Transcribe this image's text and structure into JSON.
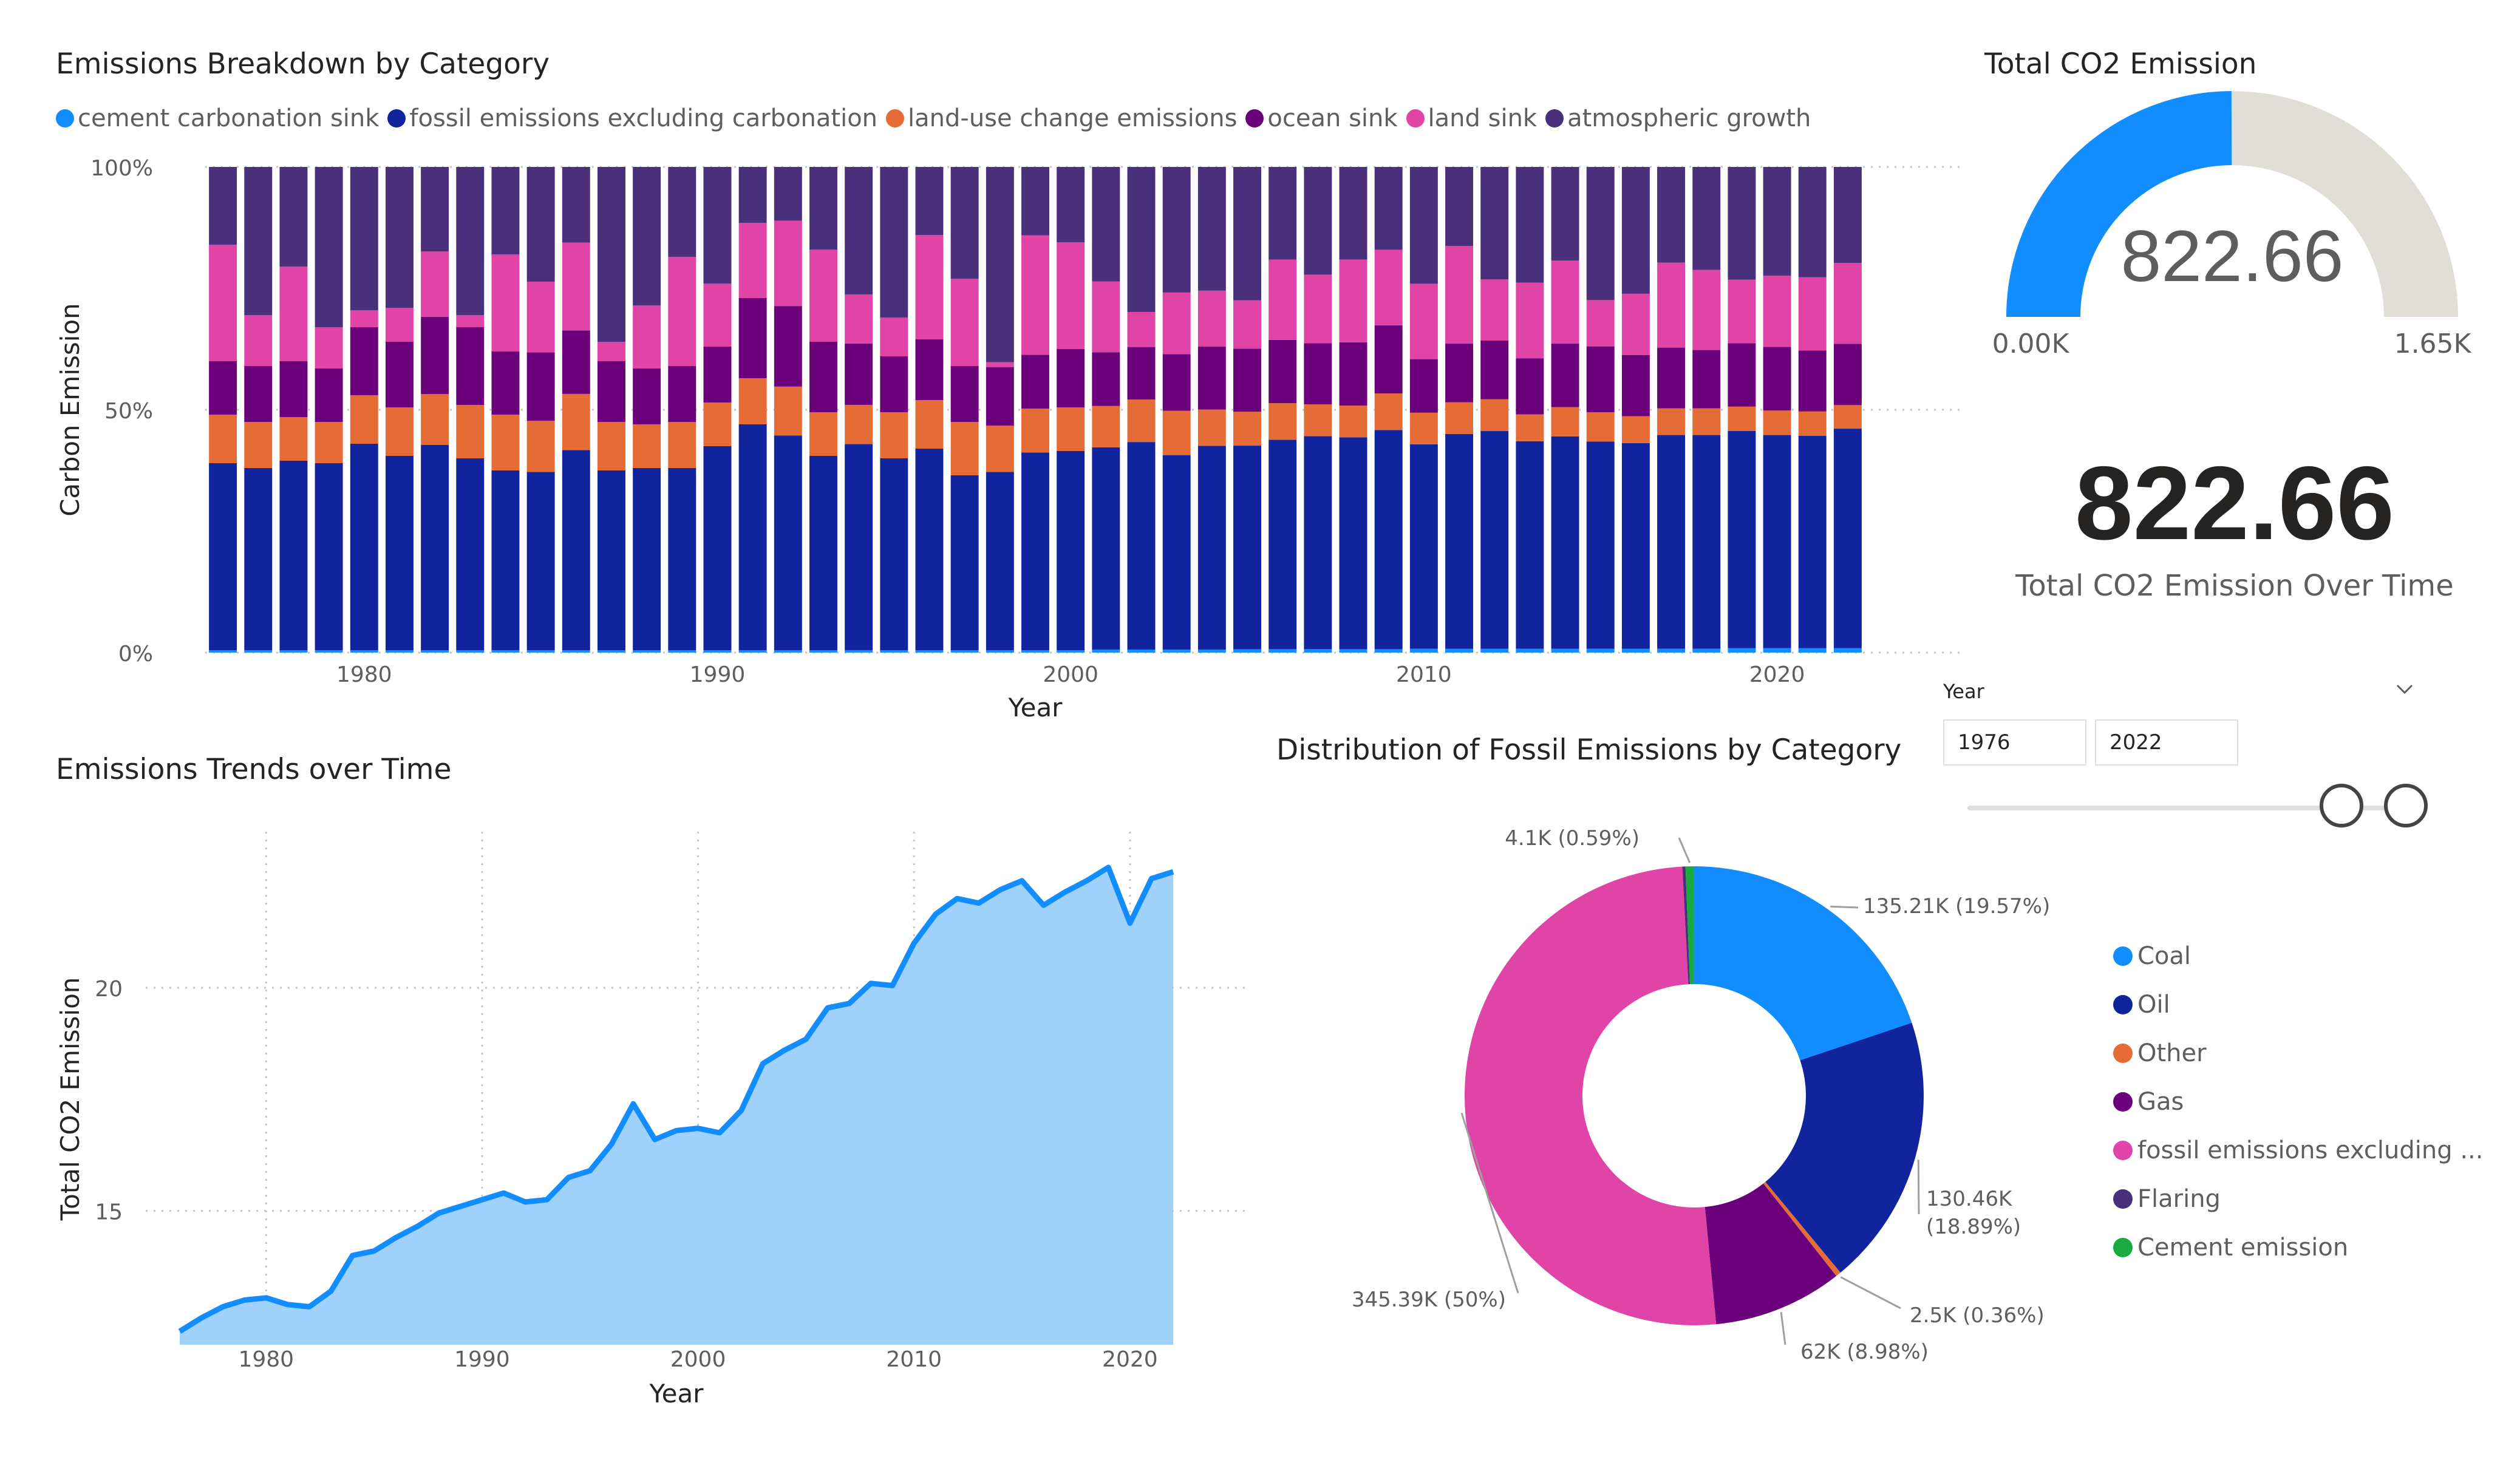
{
  "colors": {
    "cement_sink": "#118dff",
    "fossil": "#12239e",
    "landuse": "#e66c37",
    "ocean": "#6b007b",
    "land_sink": "#e044a7",
    "atmos": "#4a2f7a",
    "area_fill": "#9fd1fb",
    "area_line": "#118dff",
    "gauge_fill": "#118dff",
    "gauge_bg": "#e1ddd7"
  },
  "breakdown": {
    "title": "Emissions Breakdown by Category",
    "legend": [
      {
        "label": "cement carbonation sink",
        "color": "#118dff"
      },
      {
        "label": "fossil emissions excluding carbonation",
        "color": "#12239e"
      },
      {
        "label": "land-use change emissions",
        "color": "#e66c37"
      },
      {
        "label": "ocean sink",
        "color": "#6b007b"
      },
      {
        "label": "land sink",
        "color": "#e044a7"
      },
      {
        "label": "atmospheric growth",
        "color": "#4a2f7a"
      }
    ]
  },
  "trend": {
    "title": "Emissions Trends over Time"
  },
  "gauge": {
    "title": "Total CO2 Emission",
    "value_text": "822.66",
    "min_label": "0.00K",
    "max_label": "1.65K",
    "fraction": 0.499
  },
  "card": {
    "value": "822.66",
    "label": "Total CO2 Emission Over Time"
  },
  "slicer": {
    "label": "Year",
    "from": "1976",
    "to": "2022",
    "chevron": "chevron-down-icon"
  },
  "pie": {
    "title": "Distribution of Fossil Emissions by Category",
    "legend": [
      {
        "label": "Coal",
        "color": "#118dff"
      },
      {
        "label": "Oil",
        "color": "#12239e"
      },
      {
        "label": "Other",
        "color": "#e66c37"
      },
      {
        "label": "Gas",
        "color": "#6b007b"
      },
      {
        "label": "fossil emissions excluding ...",
        "color": "#e044a7"
      },
      {
        "label": "Flaring",
        "color": "#4a2f7a"
      },
      {
        "label": "Cement emission",
        "color": "#1aab40"
      }
    ]
  },
  "chart_data": [
    {
      "type": "bar",
      "stacked": "percent",
      "title": "Emissions Breakdown by Category",
      "xlabel": "Year",
      "ylabel": "Carbon Emission",
      "y_ticks": [
        "0%",
        "50%",
        "100%"
      ],
      "x_ticks": [
        "1980",
        "1990",
        "2000",
        "2010",
        "2020"
      ],
      "legend_position": "top-left",
      "categories": [
        1976,
        1977,
        1978,
        1979,
        1980,
        1981,
        1982,
        1983,
        1984,
        1985,
        1986,
        1987,
        1988,
        1989,
        1990,
        1991,
        1992,
        1993,
        1994,
        1995,
        1996,
        1997,
        1998,
        1999,
        2000,
        2001,
        2002,
        2003,
        2004,
        2005,
        2006,
        2007,
        2008,
        2009,
        2010,
        2011,
        2012,
        2013,
        2014,
        2015,
        2016,
        2017,
        2018,
        2019,
        2020,
        2021,
        2022
      ],
      "series": [
        {
          "name": "cement carbonation sink",
          "values": [
            0.5,
            0.5,
            0.5,
            0.5,
            0.5,
            0.5,
            0.5,
            0.5,
            0.5,
            0.5,
            0.5,
            0.5,
            0.5,
            0.5,
            0.5,
            0.5,
            0.5,
            0.5,
            0.5,
            0.5,
            0.5,
            0.5,
            0.5,
            0.5,
            0.5,
            0.6,
            0.6,
            0.6,
            0.6,
            0.7,
            0.7,
            0.7,
            0.7,
            0.7,
            0.8,
            0.8,
            0.8,
            0.8,
            0.8,
            0.8,
            0.8,
            0.8,
            0.8,
            0.9,
            0.9,
            0.9,
            0.9
          ]
        },
        {
          "name": "fossil emissions excluding carbonation",
          "values": [
            38.5,
            37.5,
            39,
            38.5,
            42.5,
            40,
            42.5,
            39.5,
            37,
            36.5,
            41,
            37,
            37.5,
            37.5,
            42,
            46.5,
            44,
            40,
            42,
            39.5,
            41.5,
            36,
            36.5,
            40.5,
            41,
            41.5,
            41.5,
            39.5,
            42,
            42,
            43,
            43.5,
            43.5,
            45,
            42,
            44,
            44.5,
            42.5,
            43.5,
            42.5,
            42,
            44,
            44,
            44.5,
            43.5,
            43.5,
            44.8
          ]
        },
        {
          "name": "land-use change emissions",
          "values": [
            10,
            9.5,
            9,
            8.5,
            10,
            10,
            10.5,
            11,
            11.5,
            10.5,
            11.5,
            10,
            9,
            9.5,
            9,
            9.5,
            10,
            9,
            8,
            9.5,
            10,
            11,
            9.5,
            9,
            9,
            8.5,
            8.5,
            9,
            7.5,
            7,
            7.5,
            6.5,
            6.5,
            7.5,
            6.5,
            6.5,
            6.5,
            5.5,
            6,
            6,
            5.5,
            5.5,
            5.5,
            5,
            5,
            5,
            4.8
          ]
        },
        {
          "name": "ocean sink",
          "values": [
            11,
            11.5,
            11.5,
            11,
            14,
            13.5,
            16,
            16,
            13,
            14,
            13,
            12.5,
            11.5,
            11.5,
            11.5,
            16.5,
            16.5,
            14.5,
            12.5,
            11.5,
            12.5,
            11.5,
            12,
            11,
            12,
            11,
            10.5,
            11.5,
            13,
            13,
            13,
            12.5,
            13,
            14,
            11,
            12,
            12,
            11.5,
            13,
            13.5,
            12.5,
            12.5,
            12,
            13,
            13,
            12.5,
            12.5
          ]
        },
        {
          "name": "land sink",
          "values": [
            24,
            10.5,
            19.5,
            8.5,
            3.5,
            7,
            13.5,
            2.5,
            20,
            14.5,
            18,
            4,
            13,
            22.5,
            13,
            15.5,
            17.5,
            19,
            10,
            8,
            21.5,
            18,
            1,
            24.5,
            22,
            14.5,
            7,
            12.5,
            11.5,
            10,
            16.5,
            14,
            17,
            15.5,
            15.5,
            20,
            12.5,
            15.5,
            17,
            9.5,
            12.5,
            17.5,
            16.5,
            13,
            14.5,
            15,
            16.5
          ]
        },
        {
          "name": "atmospheric growth",
          "values": [
            16,
            30.5,
            20.5,
            33,
            29.5,
            29,
            17.5,
            30.5,
            18,
            23.5,
            15.5,
            36,
            28.5,
            18.5,
            24,
            11.5,
            11,
            17,
            26,
            31,
            14,
            23,
            40,
            14,
            15.5,
            23.5,
            29,
            25.5,
            25.5,
            27.5,
            19,
            22,
            19,
            17,
            24,
            16.2,
            23,
            23.7,
            19.2,
            27.3,
            25.9,
            19.7,
            21.2,
            23.1,
            22.2,
            22.6,
            19.6
          ]
        }
      ]
    },
    {
      "type": "area",
      "title": "Emissions Trends over Time",
      "xlabel": "Year",
      "ylabel": "Total CO2 Emission",
      "y_ticks": [
        15,
        20
      ],
      "x_ticks": [
        "1980",
        "1990",
        "2000",
        "2010",
        "2020"
      ],
      "ylim": [
        12,
        23.5
      ],
      "x": [
        1976,
        1977,
        1978,
        1979,
        1980,
        1981,
        1982,
        1983,
        1984,
        1985,
        1986,
        1987,
        1988,
        1989,
        1990,
        1991,
        1992,
        1993,
        1994,
        1995,
        1996,
        1997,
        1998,
        1999,
        2000,
        2001,
        2002,
        2003,
        2004,
        2005,
        2006,
        2007,
        2008,
        2009,
        2010,
        2011,
        2012,
        2013,
        2014,
        2015,
        2016,
        2017,
        2018,
        2019,
        2020,
        2021,
        2022
      ],
      "values": [
        12.3,
        12.6,
        12.85,
        13.0,
        13.05,
        12.9,
        12.85,
        13.2,
        14.0,
        14.1,
        14.4,
        14.65,
        14.95,
        15.1,
        15.25,
        15.4,
        15.2,
        15.25,
        15.75,
        15.9,
        16.5,
        17.4,
        16.6,
        16.8,
        16.85,
        16.75,
        17.25,
        18.3,
        18.6,
        18.85,
        19.55,
        19.65,
        20.1,
        20.05,
        21.0,
        21.65,
        22.0,
        21.9,
        22.2,
        22.4,
        21.85,
        22.15,
        22.4,
        22.7,
        21.45,
        22.45,
        22.6
      ]
    },
    {
      "type": "pie",
      "donut": true,
      "title": "Distribution of Fossil Emissions by Category",
      "legend_position": "right",
      "slices": [
        {
          "label": "Coal",
          "value": 135.21,
          "data_label": "135.21K (19.57%)"
        },
        {
          "label": "Oil",
          "value": 130.46,
          "data_label": "130.46K (18.89%)"
        },
        {
          "label": "Other",
          "value": 2.5,
          "data_label": "2.5K (0.36%)"
        },
        {
          "label": "Gas",
          "value": 62,
          "data_label": "62K (8.98%)"
        },
        {
          "label": "fossil emissions excluding ...",
          "value": 345.39,
          "data_label": "345.39K (50%)"
        },
        {
          "label": "Flaring",
          "value": 1.5,
          "data_label": ""
        },
        {
          "label": "Cement emission",
          "value": 4.1,
          "data_label": "4.1K (0.59%)"
        }
      ]
    }
  ]
}
